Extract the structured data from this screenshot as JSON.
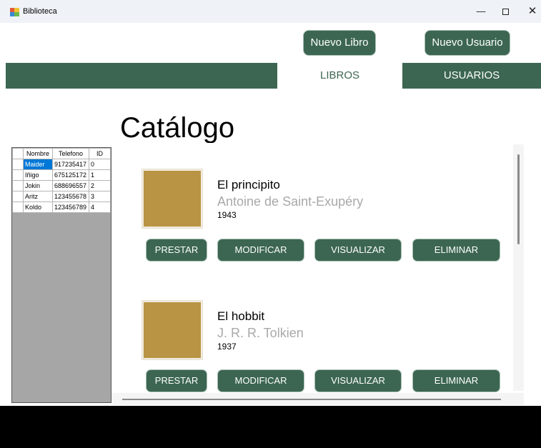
{
  "window": {
    "title": "Biblioteca",
    "minimize_glyph": "—",
    "close_glyph": "✕"
  },
  "toolbar": {
    "nuevo_libro": "Nuevo Libro",
    "nuevo_usuario": "Nuevo Usuario"
  },
  "tabs": {
    "libros": "LIBROS",
    "usuarios": "USUARIOS"
  },
  "catalog": {
    "heading": "Catálogo",
    "books": [
      {
        "title": "El principito",
        "author": "Antoine de Saint-Exupéry",
        "year": "1943"
      },
      {
        "title": "El hobbit",
        "author": "J. R. R. Tolkien",
        "year": "1937"
      }
    ],
    "actions": {
      "prestar": "PRESTAR",
      "modificar": "MODIFICAR",
      "visualizar": "VISUALIZAR",
      "eliminar": "ELIMINAR"
    }
  },
  "users_grid": {
    "columns": [
      "Nombre",
      "Telefono",
      "ID"
    ],
    "rows": [
      [
        "Maider",
        "917235417",
        "0"
      ],
      [
        "Iñigo",
        "675125172",
        "1"
      ],
      [
        "Jokin",
        "688696557",
        "2"
      ],
      [
        "Aritz",
        "123455678",
        "3"
      ],
      [
        "Koldo",
        "123456789",
        "4"
      ]
    ],
    "selected_row": 0
  },
  "colors": {
    "accent": "#3c6652",
    "cover": "#b89444",
    "selection": "#0078d7",
    "grid_empty": "#a6a6a6"
  }
}
